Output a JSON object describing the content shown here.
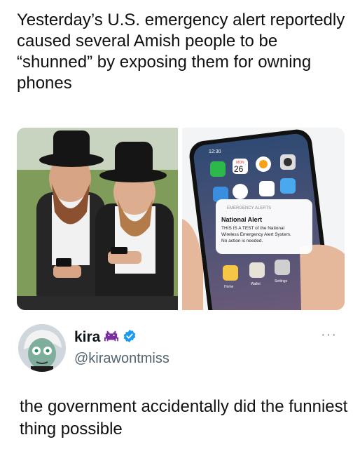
{
  "headline": "Yesterday’s U.S. emergency alert reportedly caused several Amish people to be “shunned” by exposing them for owning phones",
  "phone": {
    "time": "12:30",
    "calendar_day": "MON",
    "calendar_date": "26",
    "apps_row1": [
      "FaceTime",
      "Calendar",
      "Photos",
      "Camera"
    ],
    "dock": [
      "Home",
      "Wallet",
      "Settings"
    ],
    "alert_header": "EMERGENCY ALERTS",
    "alert_title": "National Alert",
    "alert_body_1": "THIS IS A TEST of the National",
    "alert_body_2": "Wireless Emergency Alert System.",
    "alert_body_3": "No action is needed."
  },
  "tweet": {
    "display_name": "kira",
    "handle": "@kirawontmiss",
    "text": "the government accidentally did the funniest thing possible",
    "more_label": "···",
    "emoji_icon": "space-invader-icon",
    "verified_icon": "verified-badge-icon",
    "verified_color": "#1d9bf0",
    "emoji_color": "#7a2da0"
  }
}
